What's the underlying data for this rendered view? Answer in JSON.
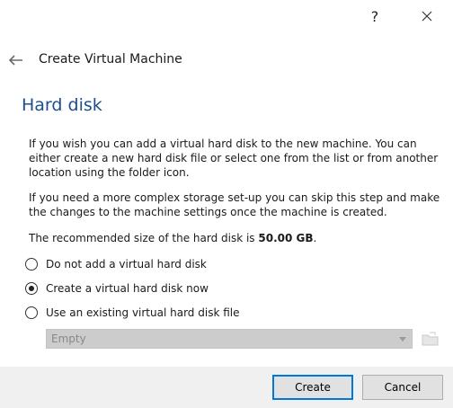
{
  "titlebar": {
    "help_label": "?"
  },
  "header": {
    "title": "Create Virtual Machine"
  },
  "section": {
    "title": "Hard disk"
  },
  "description": {
    "p1": "If you wish you can add a virtual hard disk to the new machine. You can either create a new hard disk file or select one from the list or from another location using the folder icon.",
    "p2": "If you need a more complex storage set-up you can skip this step and make the changes to the machine settings once the machine is created.",
    "p3_prefix": "The recommended size of the hard disk is ",
    "p3_size": "50.00 GB",
    "p3_suffix": "."
  },
  "options": [
    {
      "label": "Do not add a virtual hard disk",
      "selected": false
    },
    {
      "label": "Create a virtual hard disk now",
      "selected": true
    },
    {
      "label": "Use an existing virtual hard disk file",
      "selected": false
    }
  ],
  "disk_select": {
    "value": "Empty",
    "enabled": false
  },
  "buttons": {
    "create": "Create",
    "cancel": "Cancel"
  },
  "colors": {
    "accent": "#0078d7",
    "section_title": "#1f4e8c"
  }
}
